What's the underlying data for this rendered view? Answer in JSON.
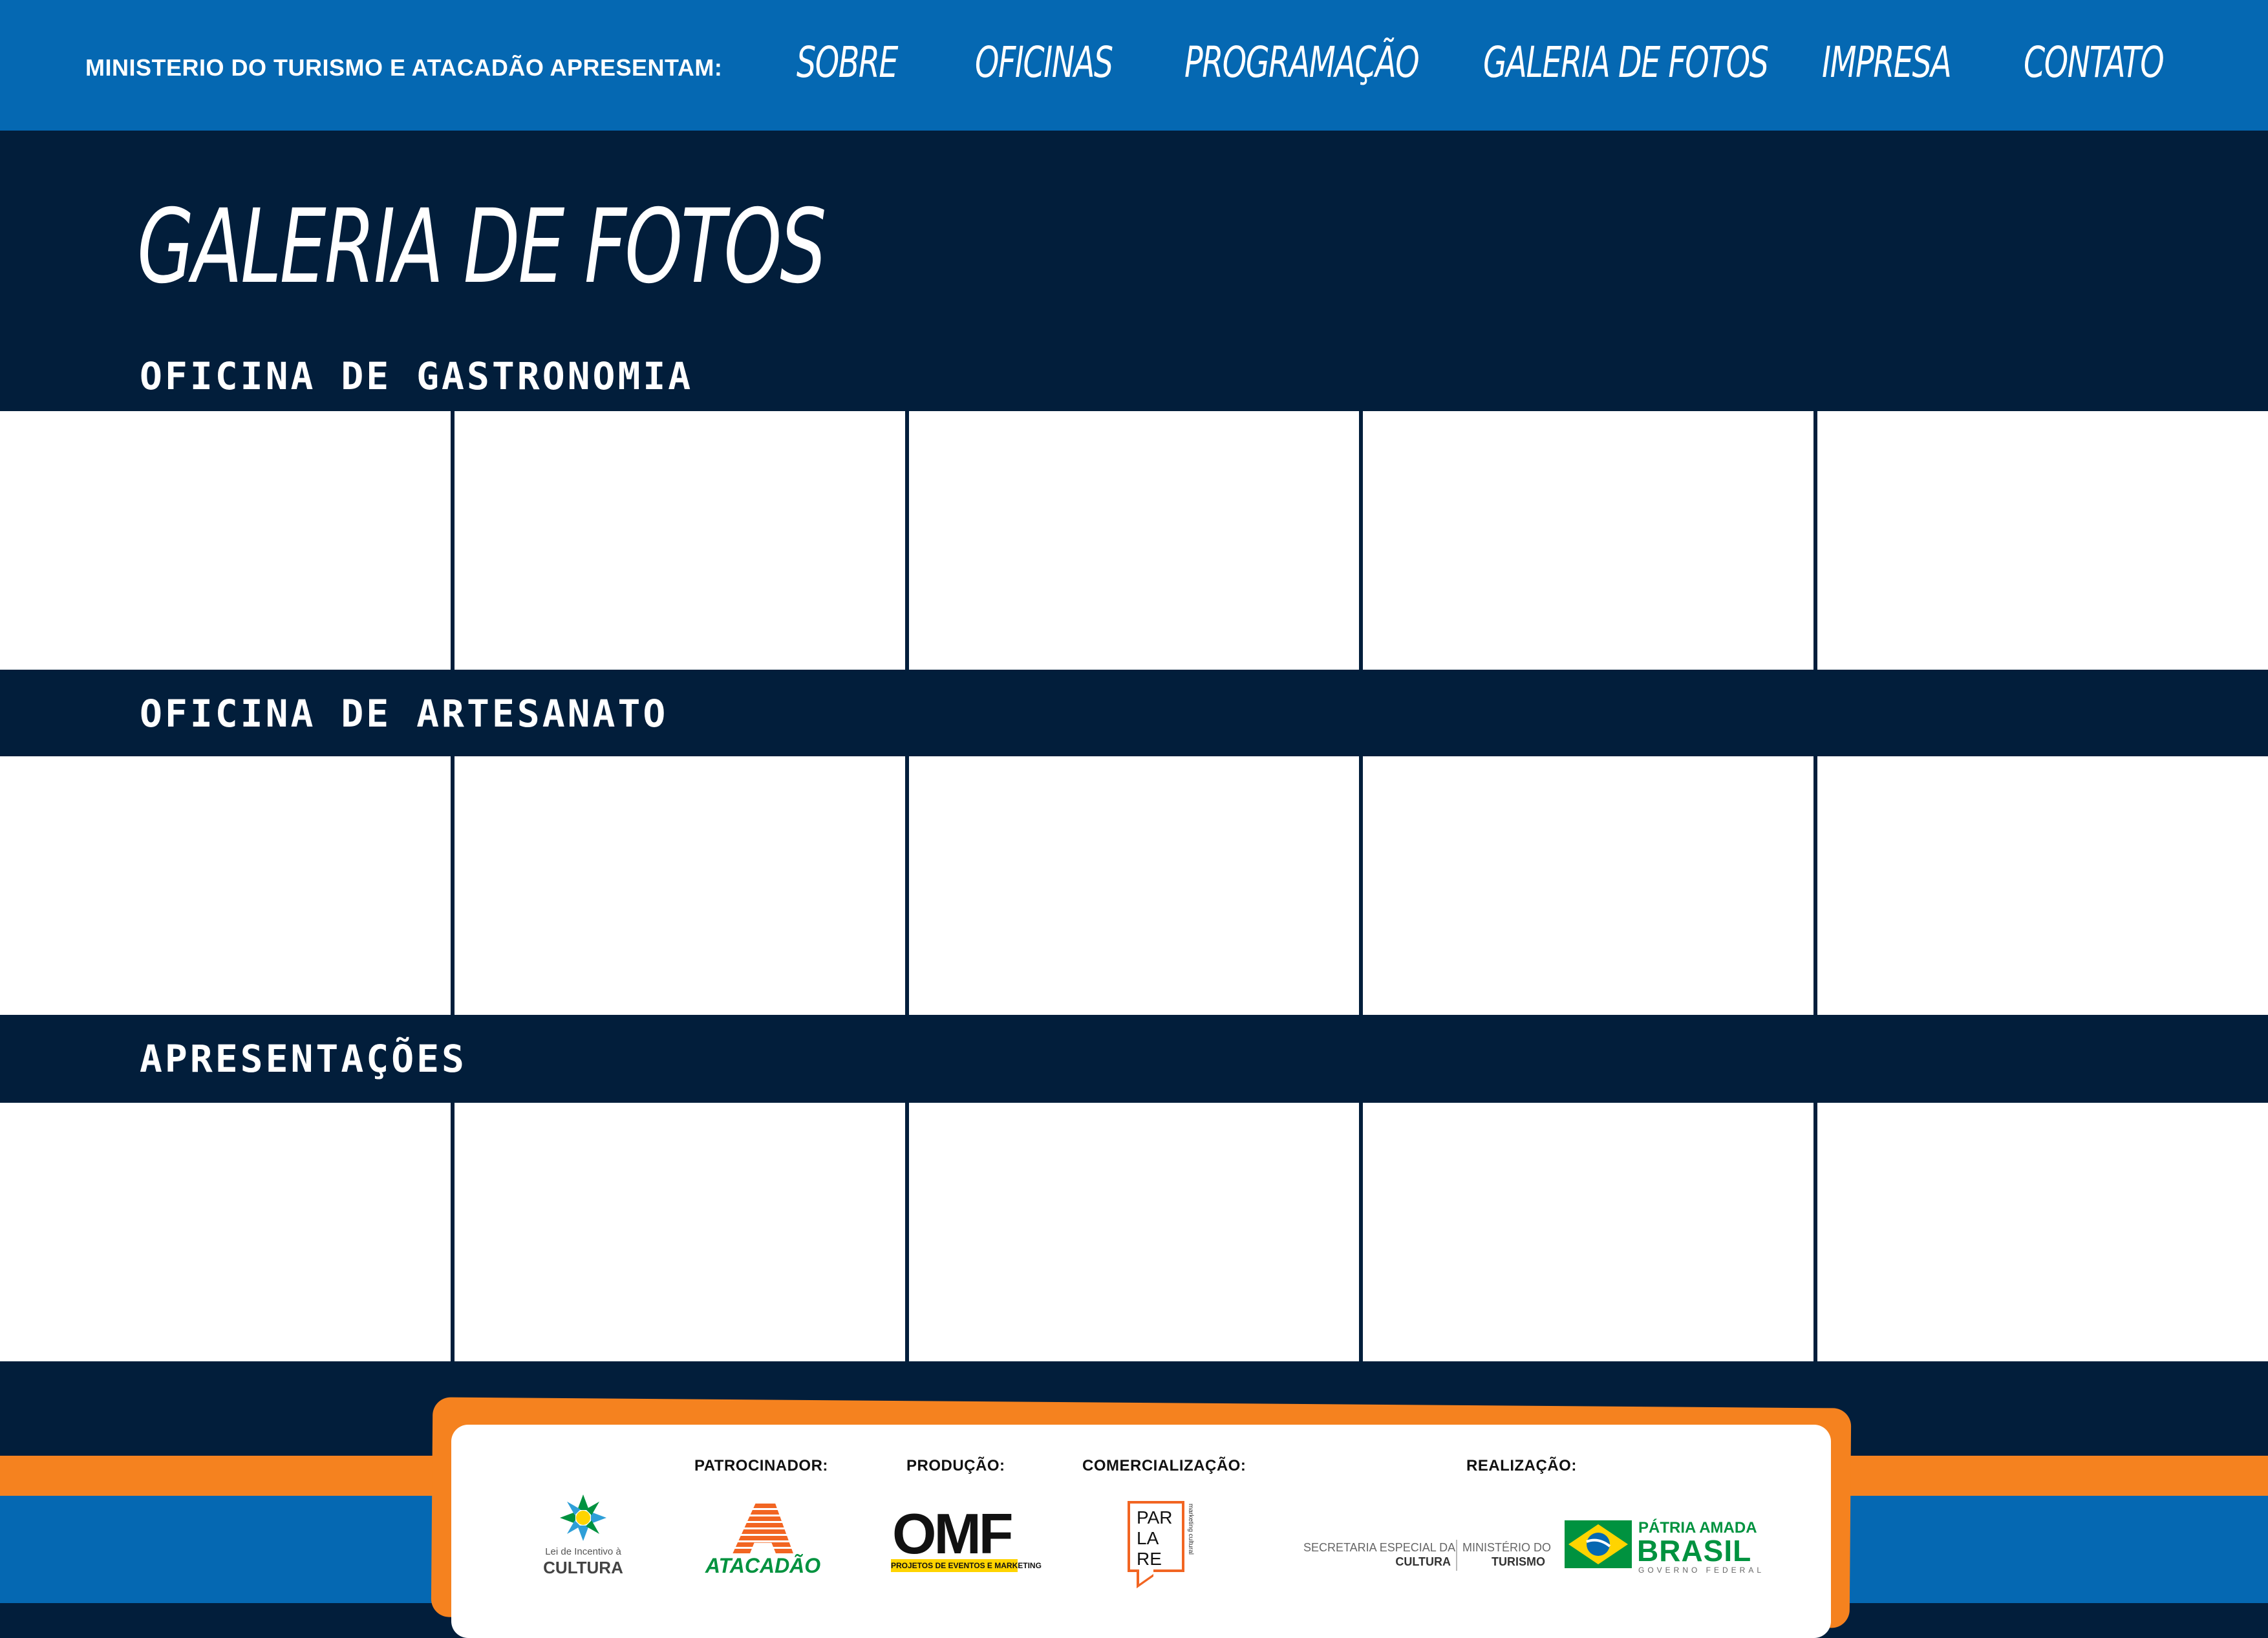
{
  "header": {
    "presenter": "MINISTERIO DO TURISMO E ATACADÃO APRESENTAM:",
    "nav": [
      {
        "label": "SOBRE"
      },
      {
        "label": "OFICINAS"
      },
      {
        "label": "PROGRAMAÇÃO"
      },
      {
        "label": "GALERIA DE FOTOS"
      },
      {
        "label": "IMPRESA"
      },
      {
        "label": "CONTATO"
      }
    ]
  },
  "page": {
    "title": "GALERIA DE FOTOS",
    "sections": [
      {
        "title": "OFICINA DE GASTRONOMIA",
        "photos": 5
      },
      {
        "title": "OFICINA DE ARTESANATO",
        "photos": 5
      },
      {
        "title": "APRESENTAÇÕES",
        "photos": 5
      }
    ]
  },
  "footer": {
    "labels": {
      "patrocinador": "PATROCINADOR:",
      "producao": "PRODUÇÃO:",
      "comercializacao": "COMERCIALIZAÇÃO:",
      "realizacao": "REALIZAÇÃO:"
    },
    "logos": {
      "lei_incentivo": {
        "line1": "Lei de Incentivo à",
        "line2": "CULTURA"
      },
      "atacadao": {
        "mark": "A",
        "name": "ATACADÃO"
      },
      "omf": {
        "mark": "OMF",
        "tagline": "PROJETOS DE EVENTOS E MARKETING"
      },
      "parlare": {
        "l1": "PAR",
        "l2": "LA",
        "l3": "RE",
        "side": "marketing cultural"
      },
      "secretaria": {
        "l1": "SECRETARIA ESPECIAL DA",
        "l2": "CULTURA"
      },
      "ministerio": {
        "l1": "MINISTÉRIO DO",
        "l2": "TURISMO"
      },
      "governo": {
        "l1": "PÁTRIA AMADA",
        "l2": "BRASIL",
        "l3": "GOVERNO FEDERAL"
      }
    },
    "colors": {
      "navy": "#021e3b",
      "blue": "#0568b2",
      "orange": "#f5821f",
      "green": "#00923f",
      "yellow": "#ffd400"
    }
  }
}
